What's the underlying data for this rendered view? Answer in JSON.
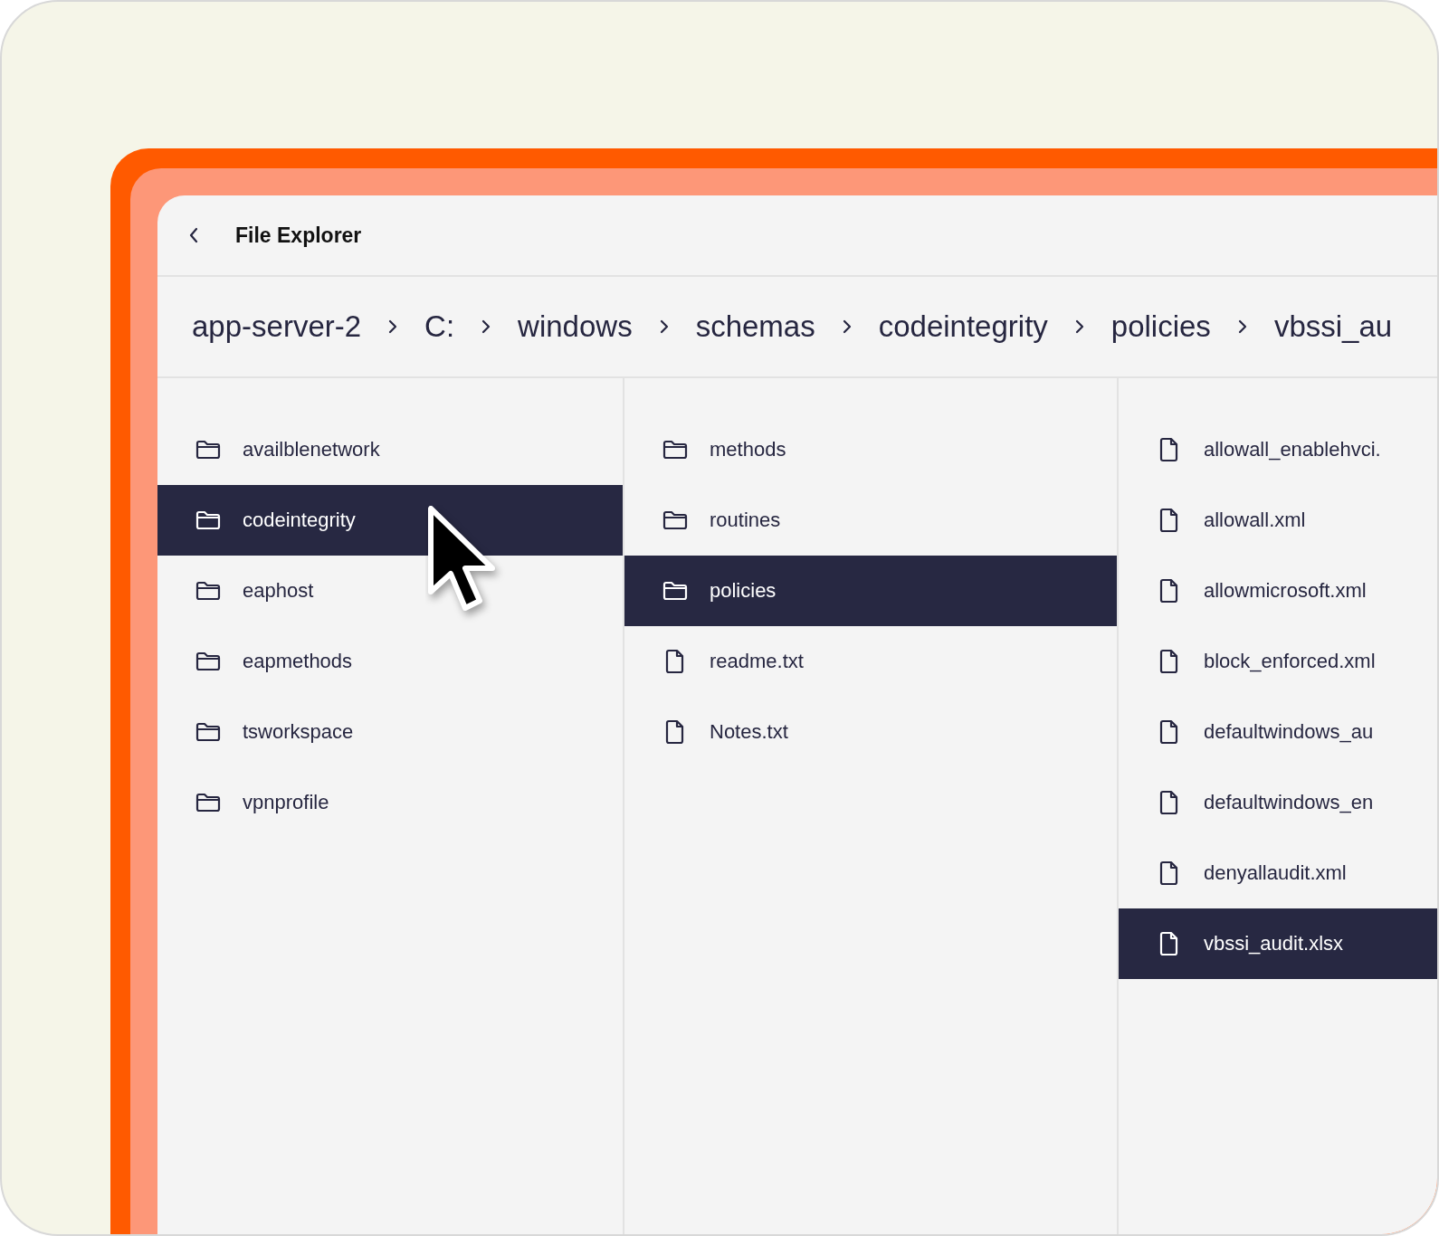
{
  "window": {
    "title": "File Explorer"
  },
  "breadcrumb": [
    "app-server-2",
    "C:",
    "windows",
    "schemas",
    "codeintegrity",
    "policies",
    "vbssi_au"
  ],
  "columns": [
    {
      "items": [
        {
          "name": "availblenetwork",
          "kind": "folder",
          "selected": false
        },
        {
          "name": "codeintegrity",
          "kind": "folder",
          "selected": true
        },
        {
          "name": "eaphost",
          "kind": "folder",
          "selected": false
        },
        {
          "name": "eapmethods",
          "kind": "folder",
          "selected": false
        },
        {
          "name": "tsworkspace",
          "kind": "folder",
          "selected": false
        },
        {
          "name": "vpnprofile",
          "kind": "folder",
          "selected": false
        }
      ]
    },
    {
      "items": [
        {
          "name": "methods",
          "kind": "folder",
          "selected": false
        },
        {
          "name": "routines",
          "kind": "folder",
          "selected": false
        },
        {
          "name": "policies",
          "kind": "folder",
          "selected": true
        },
        {
          "name": "readme.txt",
          "kind": "file",
          "selected": false
        },
        {
          "name": "Notes.txt",
          "kind": "file",
          "selected": false
        }
      ]
    },
    {
      "items": [
        {
          "name": "allowall_enablehvci.",
          "kind": "file",
          "selected": false
        },
        {
          "name": "allowall.xml",
          "kind": "file",
          "selected": false
        },
        {
          "name": "allowmicrosoft.xml",
          "kind": "file",
          "selected": false
        },
        {
          "name": "block_enforced.xml",
          "kind": "file",
          "selected": false
        },
        {
          "name": "defaultwindows_au",
          "kind": "file",
          "selected": false
        },
        {
          "name": "defaultwindows_en",
          "kind": "file",
          "selected": false
        },
        {
          "name": "denyallaudit.xml",
          "kind": "file",
          "selected": false
        },
        {
          "name": "vbssi_audit.xlsx",
          "kind": "file",
          "selected": true
        }
      ]
    }
  ]
}
